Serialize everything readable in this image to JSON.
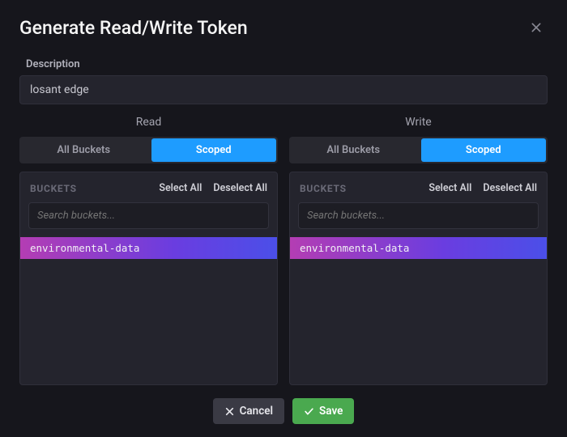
{
  "modal": {
    "title": "Generate Read/Write Token"
  },
  "description": {
    "label": "Description",
    "value": "losant edge"
  },
  "panels": {
    "read": {
      "title": "Read",
      "toggles": {
        "all": "All Buckets",
        "scoped": "Scoped",
        "active": "scoped"
      },
      "buckets_label": "BUCKETS",
      "select_all": "Select All",
      "deselect_all": "Deselect All",
      "search_placeholder": "Search buckets...",
      "items": [
        "environmental-data"
      ]
    },
    "write": {
      "title": "Write",
      "toggles": {
        "all": "All Buckets",
        "scoped": "Scoped",
        "active": "scoped"
      },
      "buckets_label": "BUCKETS",
      "select_all": "Select All",
      "deselect_all": "Deselect All",
      "search_placeholder": "Search buckets...",
      "items": [
        "environmental-data"
      ]
    }
  },
  "footer": {
    "cancel": "Cancel",
    "save": "Save"
  }
}
